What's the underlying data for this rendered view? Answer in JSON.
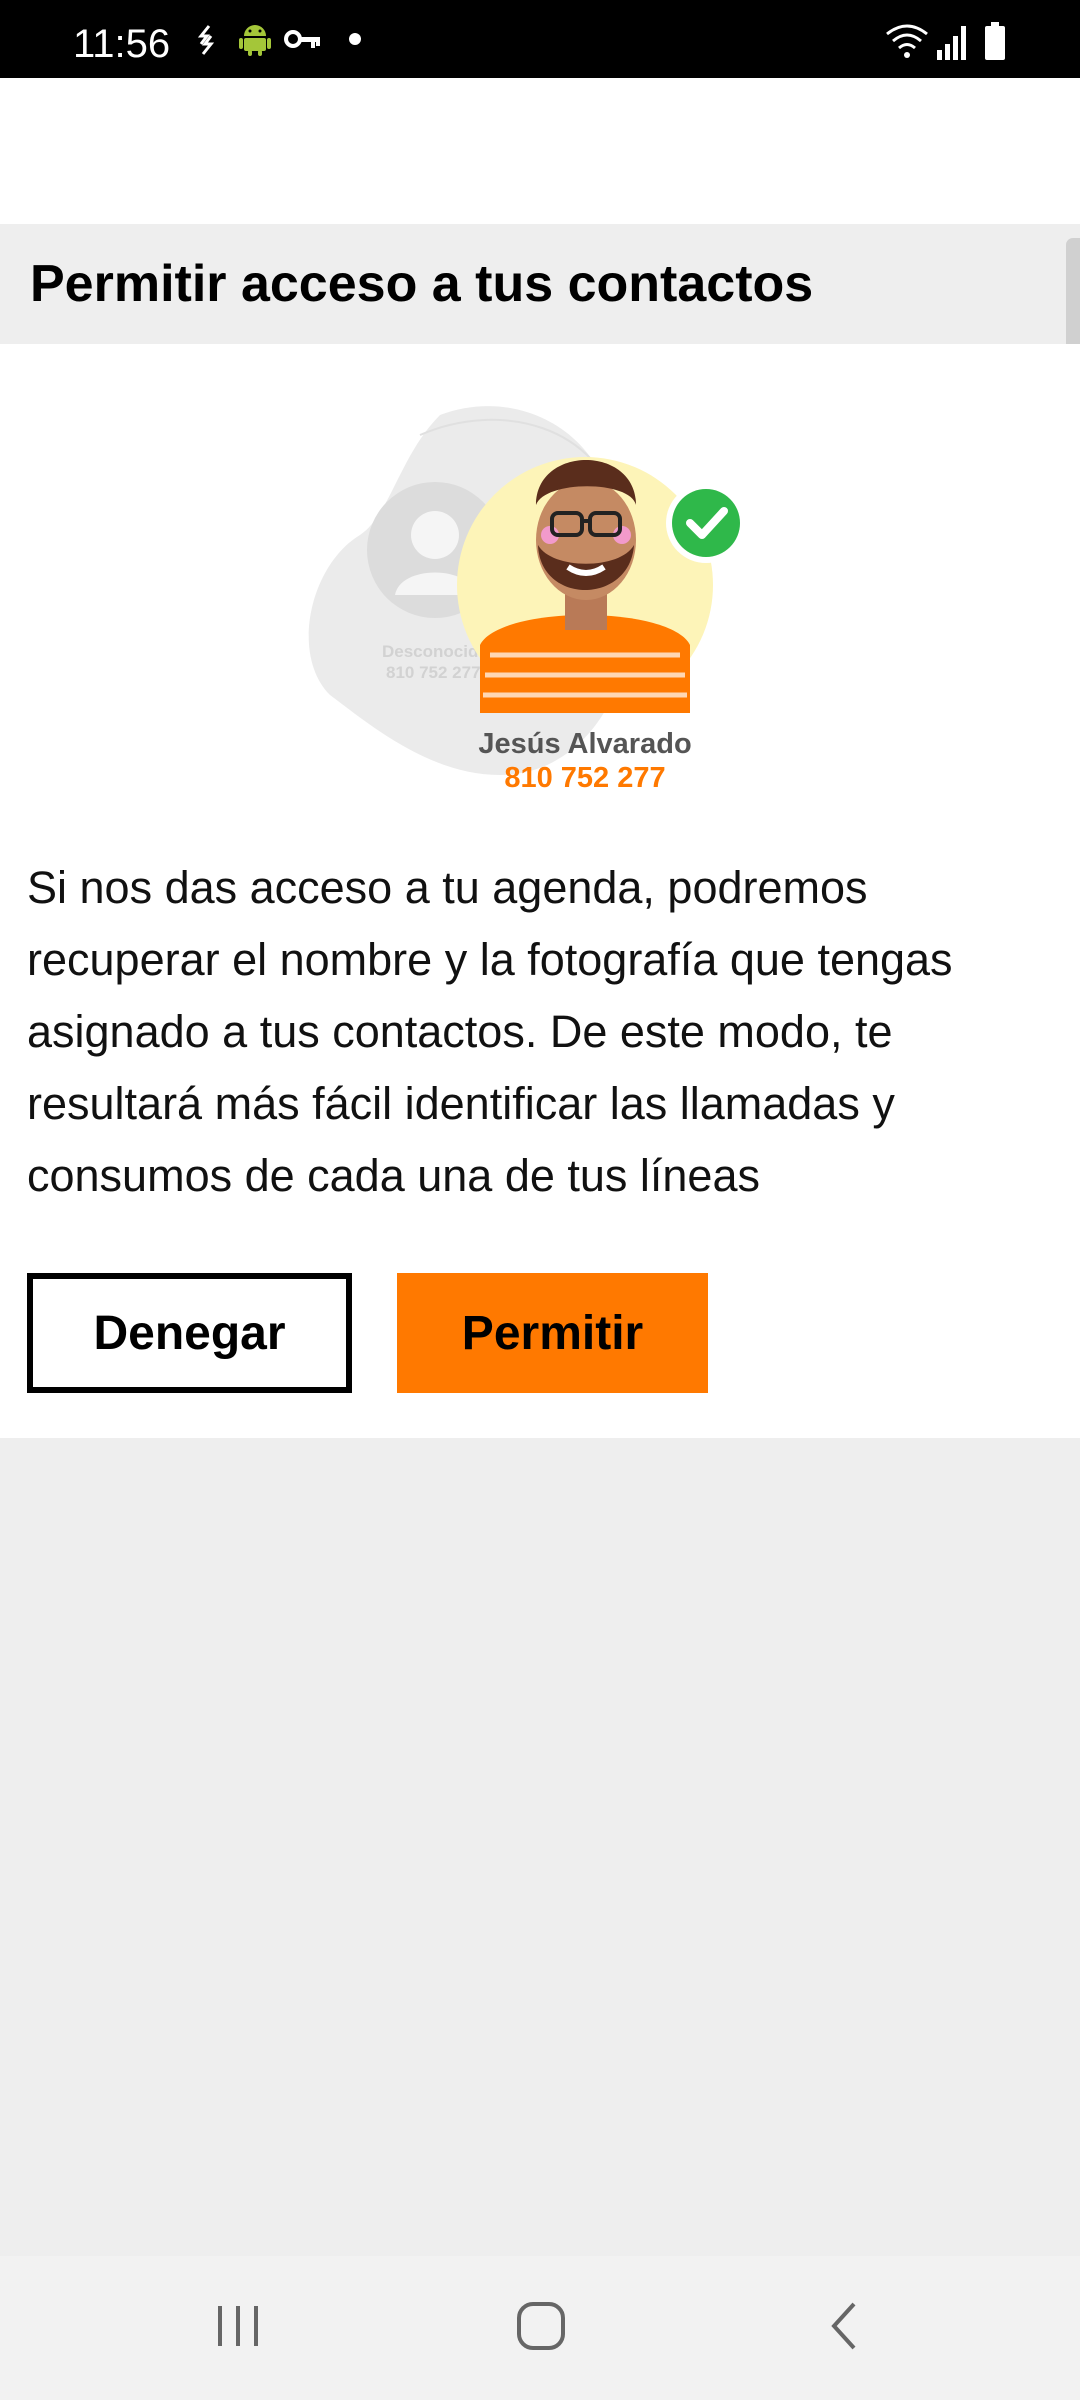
{
  "status_bar": {
    "time": "11:56",
    "icons": [
      "sync-icon",
      "android-icon",
      "vpn-key-icon",
      "dot-icon",
      "wifi-icon",
      "signal-icon",
      "battery-icon"
    ]
  },
  "header": {
    "title": "Permitir acceso a tus contactos"
  },
  "illustration": {
    "unknown_label": "Desconocido",
    "unknown_number": "810 752 277",
    "contact_name": "Jesús Alvarado",
    "contact_number": "810 752 277"
  },
  "description": "Si nos das acceso a tu agenda, podremos recuperar el nombre y la fotografía que tengas asignado a tus contactos. De este modo, te resultará más fácil identificar las llamadas y consumos de cada una de tus líneas",
  "buttons": {
    "deny": "Denegar",
    "allow": "Permitir"
  },
  "colors": {
    "accent": "#ff7900",
    "check": "#2fb84a",
    "background": "#eeeeee"
  },
  "nav_bar": {
    "icons": [
      "recent-apps-icon",
      "home-icon",
      "back-icon"
    ]
  }
}
